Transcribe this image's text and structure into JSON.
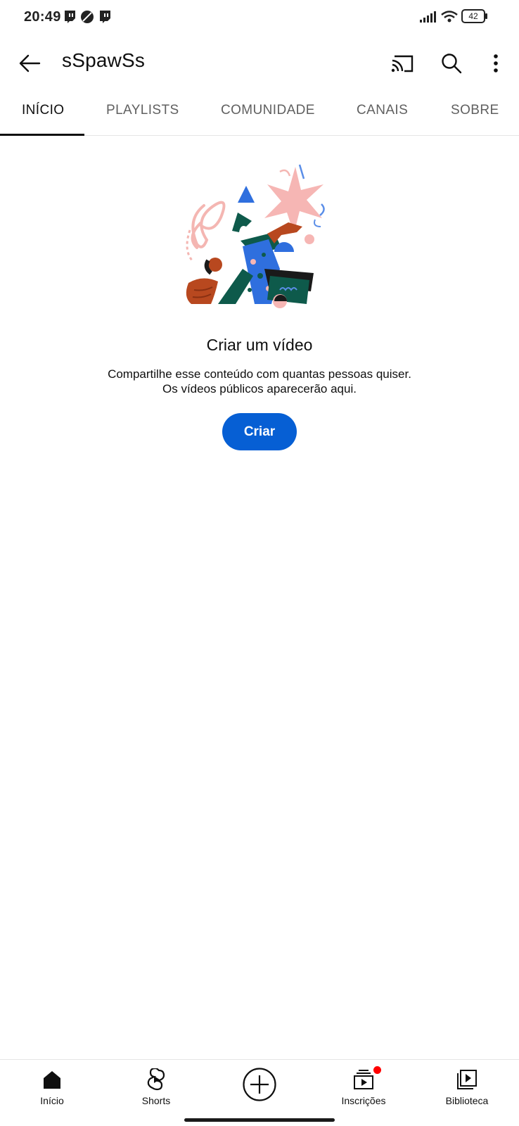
{
  "status": {
    "time": "20:49",
    "battery": "42"
  },
  "header": {
    "channel_name": "sSpawSs"
  },
  "tabs": [
    {
      "label": "INÍCIO",
      "active": true
    },
    {
      "label": "PLAYLISTS",
      "active": false
    },
    {
      "label": "COMUNIDADE",
      "active": false
    },
    {
      "label": "CANAIS",
      "active": false
    },
    {
      "label": "SOBRE",
      "active": false
    }
  ],
  "empty_state": {
    "title": "Criar um vídeo",
    "line1": "Compartilhe esse conteúdo com quantas pessoas quiser.",
    "line2": "Os vídeos públicos aparecerão aqui.",
    "button": "Criar"
  },
  "bottom_nav": [
    {
      "label": "Início",
      "icon": "home-icon"
    },
    {
      "label": "Shorts",
      "icon": "shorts-icon"
    },
    {
      "label": "",
      "icon": "create-plus-icon"
    },
    {
      "label": "Inscrições",
      "icon": "subscriptions-icon",
      "badge": true
    },
    {
      "label": "Biblioteca",
      "icon": "library-icon"
    }
  ],
  "colors": {
    "accent": "#065fd4",
    "badge": "#ff0000",
    "text": "#0f0f0f",
    "tab_inactive": "#606060"
  }
}
